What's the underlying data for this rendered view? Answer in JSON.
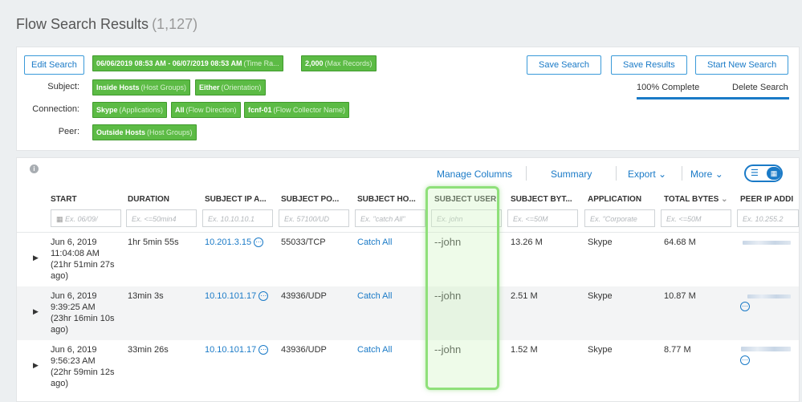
{
  "header": {
    "title": "Flow Search Results",
    "count": "(1,127)"
  },
  "criteria": {
    "edit_search": "Edit Search",
    "time_range": {
      "value": "06/06/2019 08:53 AM - 06/07/2019 08:53 AM",
      "label": "(Time Ra..."
    },
    "max_records": {
      "value": "2,000",
      "label": "(Max Records)"
    },
    "subject_label": "Subject:",
    "subject_hosts": {
      "value": "Inside Hosts",
      "label": "(Host Groups)"
    },
    "subject_orientation": {
      "value": "Either",
      "label": "(Orientation)"
    },
    "connection_label": "Connection:",
    "conn_app": {
      "value": "Skype",
      "label": "(Applications)"
    },
    "conn_direction": {
      "value": "All",
      "label": "(Flow Direction)"
    },
    "conn_collector": {
      "value": "fcnf-01",
      "label": "(Flow Collector Name)"
    },
    "peer_label": "Peer:",
    "peer_hosts": {
      "value": "Outside Hosts",
      "label": "(Host Groups)"
    },
    "save_search": "Save Search",
    "save_results": "Save Results",
    "start_new_search": "Start New Search",
    "complete": "100% Complete",
    "progress_pct": 100,
    "delete_search": "Delete Search"
  },
  "toolbar": {
    "manage_columns": "Manage Columns",
    "summary": "Summary",
    "export": "Export",
    "more": "More"
  },
  "table": {
    "columns": [
      {
        "header": "START",
        "placeholder": "Ex. 06/09/"
      },
      {
        "header": "DURATION",
        "placeholder": "Ex. <=50min4"
      },
      {
        "header": "SUBJECT IP A...",
        "placeholder": "Ex. 10.10.10.1"
      },
      {
        "header": "SUBJECT PO...",
        "placeholder": "Ex. 57100/UD"
      },
      {
        "header": "SUBJECT HO...",
        "placeholder": "Ex. \"catch All\""
      },
      {
        "header": "SUBJECT USER",
        "placeholder": "Ex. john"
      },
      {
        "header": "SUBJECT BYT...",
        "placeholder": "Ex. <=50M"
      },
      {
        "header": "APPLICATION",
        "placeholder": "Ex. \"Corporate"
      },
      {
        "header": "TOTAL BYTES",
        "placeholder": "Ex. <=50M"
      },
      {
        "header": "PEER IP ADDI",
        "placeholder": "Ex. 10.255.2"
      }
    ],
    "rows": [
      {
        "start": [
          "Jun 6, 2019",
          "11:04:08 AM",
          "(21hr 51min 27s",
          "ago)"
        ],
        "duration": "1hr 5min 55s",
        "subject_ip": "10.201.3.15",
        "subject_port": "55033/TCP",
        "subject_host": "Catch All",
        "subject_user": "--john",
        "subject_bytes": "13.26 M",
        "application": "Skype",
        "total_bytes": "64.68 M"
      },
      {
        "start": [
          "Jun 6, 2019",
          "9:39:25 AM",
          "(23hr 16min 10s",
          "ago)"
        ],
        "duration": "13min 3s",
        "subject_ip": "10.10.101.17",
        "subject_port": "43936/UDP",
        "subject_host": "Catch All",
        "subject_user": "--john",
        "subject_bytes": "2.51 M",
        "application": "Skype",
        "total_bytes": "10.87 M"
      },
      {
        "start": [
          "Jun 6, 2019",
          "9:56:23 AM",
          "(22hr 59min 12s",
          "ago)"
        ],
        "duration": "33min 26s",
        "subject_ip": "10.10.101.17",
        "subject_port": "43936/UDP",
        "subject_host": "Catch All",
        "subject_user": "--john",
        "subject_bytes": "1.52 M",
        "application": "Skype",
        "total_bytes": "8.77 M"
      }
    ]
  },
  "colors": {
    "accent": "#1a7ac7",
    "chip": "#5cbb45",
    "highlight": "#8fe07a"
  }
}
